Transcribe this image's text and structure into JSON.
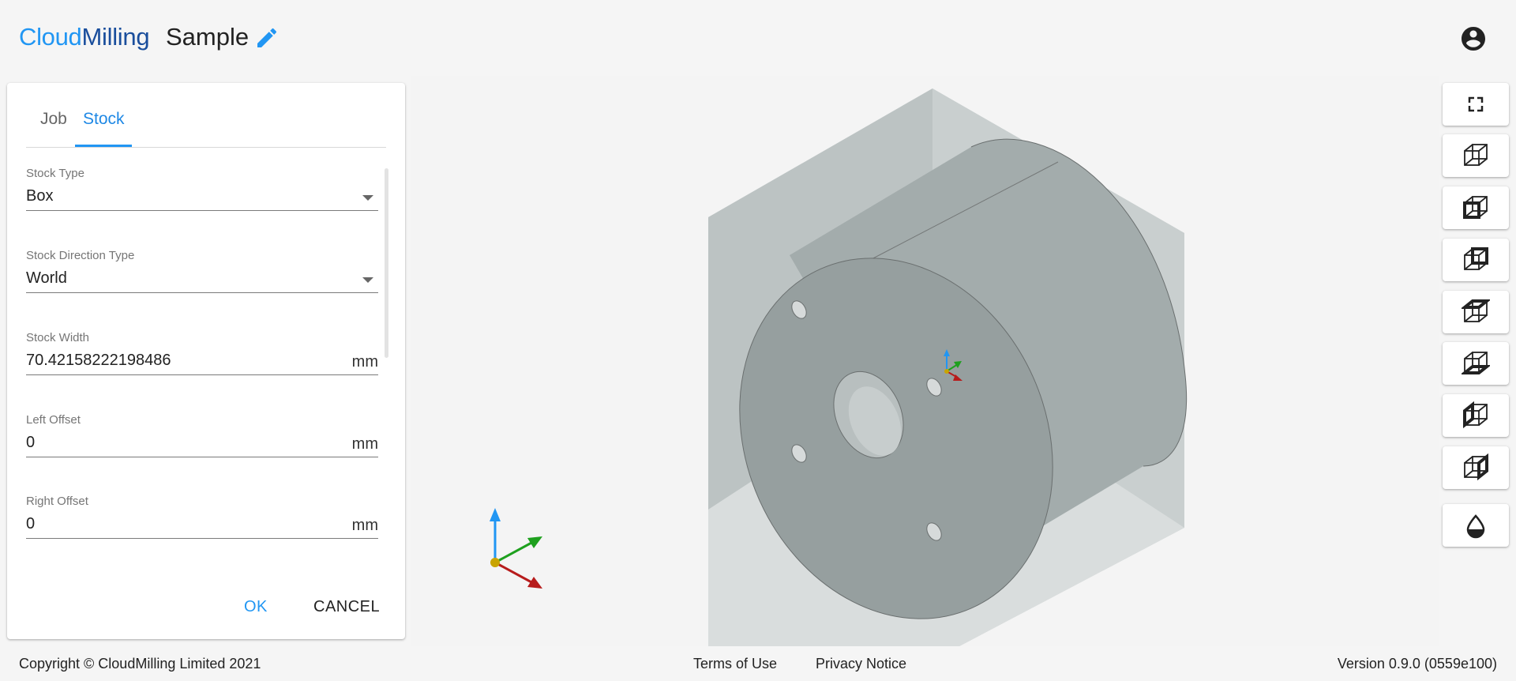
{
  "header": {
    "brand_part1": "Cloud",
    "brand_part2": "Milling",
    "project_title": "Sample",
    "edit_icon": "pencil-icon",
    "account_icon": "account-circle-icon"
  },
  "panel": {
    "tabs": [
      {
        "label": "Job",
        "active": false
      },
      {
        "label": "Stock",
        "active": true
      }
    ],
    "fields": {
      "stock_type": {
        "label": "Stock Type",
        "value": "Box"
      },
      "stock_direction": {
        "label": "Stock Direction Type",
        "value": "World"
      },
      "stock_width": {
        "label": "Stock Width",
        "value": "70.42158222198486",
        "unit": "mm"
      },
      "left_offset": {
        "label": "Left Offset",
        "value": "0",
        "unit": "mm"
      },
      "right_offset": {
        "label": "Right Offset",
        "value": "0",
        "unit": "mm"
      }
    },
    "ok_label": "OK",
    "cancel_label": "CANCEL"
  },
  "toolbar": {
    "buttons": [
      {
        "icon": "fullscreen-icon"
      },
      {
        "icon": "view-iso-cube-icon"
      },
      {
        "icon": "view-front-cube-icon"
      },
      {
        "icon": "view-back-cube-icon"
      },
      {
        "icon": "view-top-cube-icon"
      },
      {
        "icon": "view-bottom-cube-icon"
      },
      {
        "icon": "view-left-cube-icon"
      },
      {
        "icon": "view-right-cube-icon"
      },
      {
        "icon": "shading-droplet-icon"
      }
    ]
  },
  "colors": {
    "accent": "#2196f3",
    "brand_dark": "#1a4e9c",
    "axis_x": "#b71c1c",
    "axis_y": "#1ea01e",
    "axis_z": "#2196f3"
  },
  "footer": {
    "copyright": "Copyright © CloudMilling Limited 2021",
    "terms": "Terms of Use",
    "privacy": "Privacy Notice",
    "version": "Version 0.9.0 (0559e100)"
  }
}
